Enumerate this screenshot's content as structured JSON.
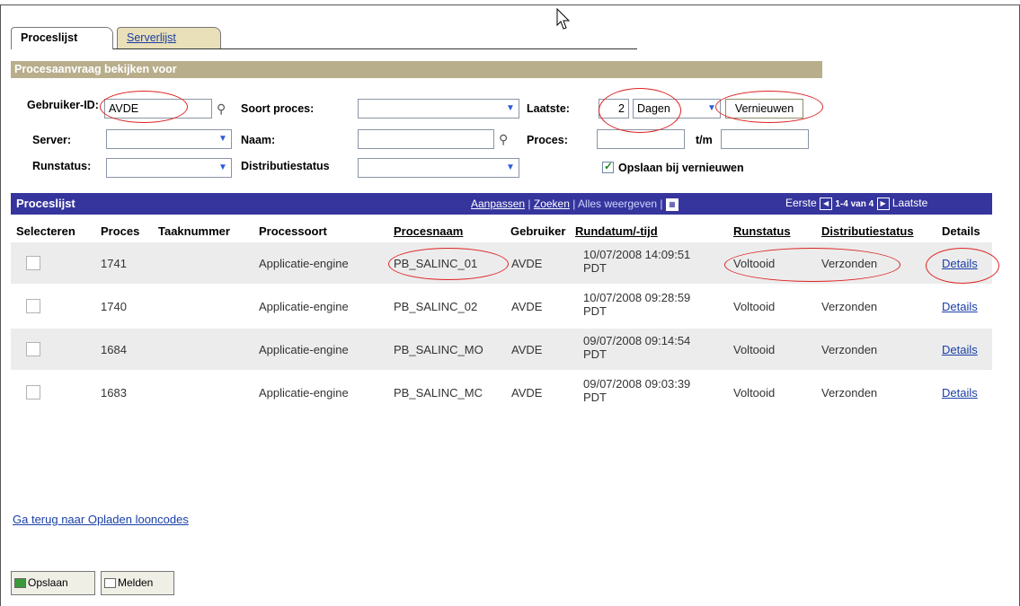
{
  "tabs": {
    "active": "Proceslijst",
    "inactive": "Serverlijst"
  },
  "section_title": "Procesaanvraag bekijken voor",
  "filters": {
    "user_id_label": "Gebruiker-ID:",
    "user_id_value": "AVDE",
    "process_type_label": "Soort proces:",
    "process_type_value": "",
    "last_label": "Laatste:",
    "last_value": "2",
    "last_unit": "Dagen",
    "refresh_button": "Vernieuwen",
    "server_label": "Server:",
    "name_label": "Naam:",
    "process_label": "Proces:",
    "to_label": "t/m",
    "runstatus_label": "Runstatus:",
    "diststatus_label": "Distributiestatus",
    "save_on_refresh_label": "Opslaan bij vernieuwen",
    "save_on_refresh_checked": true
  },
  "grid": {
    "title": "Proceslijst",
    "link_customize": "Aanpassen",
    "sep1": "|",
    "link_find": "Zoeken",
    "link_show_all": "| Alles weergeven |",
    "nav_first": "Eerste",
    "nav_range": "1-4 van 4",
    "nav_last": "Laatste",
    "columns": [
      "Selecteren",
      "Proces",
      "Taaknummer",
      "Processoort",
      "Procesnaam",
      "Gebruiker",
      "Rundatum/-tijd",
      "Runstatus",
      "Distributiestatus",
      "Details"
    ],
    "rows": [
      {
        "proces": "1741",
        "taak": "",
        "processoort": "Applicatie-engine",
        "procesnaam": "PB_SALINC_01",
        "gebruiker": "AVDE",
        "datum": "10/07/2008 14:09:51",
        "tz": "PDT",
        "runstatus": "Voltooid",
        "diststatus": "Verzonden",
        "details": "Details"
      },
      {
        "proces": "1740",
        "taak": "",
        "processoort": "Applicatie-engine",
        "procesnaam": "PB_SALINC_02",
        "gebruiker": "AVDE",
        "datum": "10/07/2008 09:28:59",
        "tz": "PDT",
        "runstatus": "Voltooid",
        "diststatus": "Verzonden",
        "details": "Details"
      },
      {
        "proces": "1684",
        "taak": "",
        "processoort": "Applicatie-engine",
        "procesnaam": "PB_SALINC_MO",
        "gebruiker": "AVDE",
        "datum": "09/07/2008 09:14:54",
        "tz": "PDT",
        "runstatus": "Voltooid",
        "diststatus": "Verzonden",
        "details": "Details"
      },
      {
        "proces": "1683",
        "taak": "",
        "processoort": "Applicatie-engine",
        "procesnaam": "PB_SALINC_MC",
        "gebruiker": "AVDE",
        "datum": "09/07/2008 09:03:39",
        "tz": "PDT",
        "runstatus": "Voltooid",
        "diststatus": "Verzonden",
        "details": "Details"
      }
    ]
  },
  "back_link": "Ga terug naar Opladen looncodes",
  "toolbar": {
    "save": "Opslaan",
    "notify": "Melden"
  },
  "colors": {
    "grid_header": "#35359d",
    "section_header": "#b8ae8c",
    "link": "#1a3fa6",
    "annotation": "#dd2222"
  }
}
